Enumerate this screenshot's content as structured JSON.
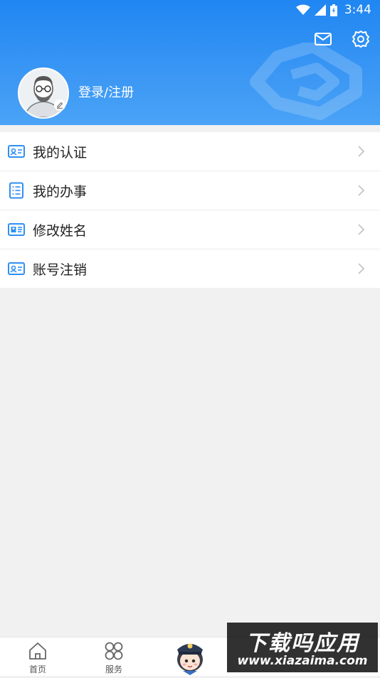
{
  "status_bar": {
    "time": "3:44",
    "icons": [
      "wifi-icon",
      "cell-signal-icon",
      "battery-icon"
    ]
  },
  "header": {
    "icons": [
      "mail-icon",
      "settings-icon"
    ],
    "login_label": "登录/注册",
    "accent_color": "#2f8ff3"
  },
  "menu": {
    "items": [
      {
        "label": "我的认证",
        "icon": "id-card-icon"
      },
      {
        "label": "我的办事",
        "icon": "task-list-icon"
      },
      {
        "label": "修改姓名",
        "icon": "name-card-icon"
      },
      {
        "label": "账号注销",
        "icon": "account-card-icon"
      }
    ]
  },
  "tabbar": {
    "tabs": [
      {
        "label": "首页",
        "icon": "home-icon"
      },
      {
        "label": "服务",
        "icon": "services-grid-icon"
      },
      {
        "label": "",
        "icon": "police-mascot-icon"
      }
    ]
  },
  "watermark": {
    "title": "下载吗应用",
    "url": "www.xiazaima.com"
  }
}
